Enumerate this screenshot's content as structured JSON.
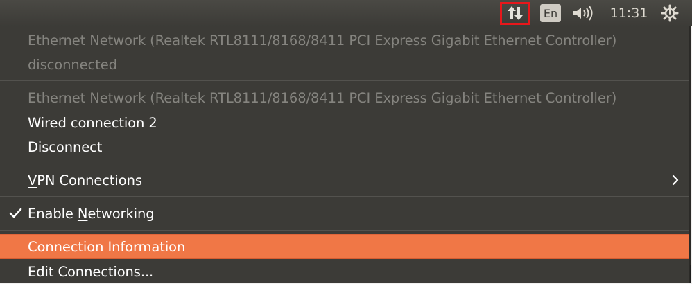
{
  "panel": {
    "language_indicator": "En",
    "clock": "11:31",
    "icons": {
      "network": "network-updown-icon",
      "volume": "speaker-volume-icon",
      "system": "gear-power-icon"
    },
    "highlight_color": "#e8171b"
  },
  "menu": {
    "ethernet1": {
      "title": "Ethernet Network (Realtek RTL8111/8168/8411 PCI Express Gigabit Ethernet Controller)",
      "status": "disconnected"
    },
    "ethernet2": {
      "title": "Ethernet Network (Realtek RTL8111/8168/8411 PCI Express Gigabit Ethernet Controller)",
      "connection": "Wired connection 2",
      "disconnect": "Disconnect"
    },
    "vpn": {
      "mnemonic": "V",
      "rest": "PN Connections"
    },
    "enable_networking": {
      "before": "Enable ",
      "mnemonic": "N",
      "after": "etworking",
      "checked": true
    },
    "connection_information": {
      "before": "Connection ",
      "mnemonic": "I",
      "after": "nformation"
    },
    "edit_connections": "Edit Connections...",
    "colors": {
      "menu_bg": "#3c3b37",
      "highlight_bg": "#f07746",
      "disabled_text": "#85847f"
    }
  }
}
